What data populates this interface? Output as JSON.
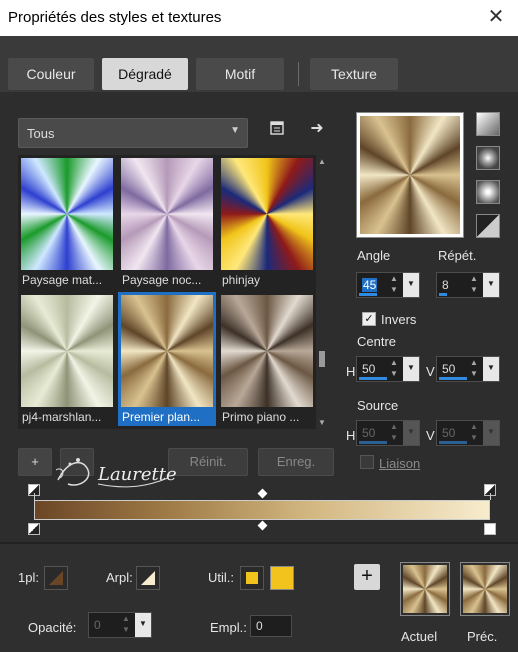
{
  "window": {
    "title": "Propriétés des styles et textures",
    "close_glyph": "✕"
  },
  "tabs": [
    {
      "label": "Couleur",
      "active": false
    },
    {
      "label": "Dégradé",
      "active": true
    },
    {
      "label": "Motif",
      "active": false
    },
    {
      "label": "Texture",
      "active": false
    }
  ],
  "category": {
    "value": "Tous"
  },
  "gradients": [
    {
      "name": "Paysage mat...",
      "colors": [
        "#1a9a2a",
        "#e8f6ff",
        "#2d3fcf",
        "#cfe8ff"
      ]
    },
    {
      "name": "Paysage noc...",
      "colors": [
        "#b59ab8",
        "#e8d6e8",
        "#7f6aa0",
        "#f1e6f0"
      ]
    },
    {
      "name": "phinjay",
      "colors": [
        "#f0c419",
        "#8f1a1a",
        "#1b2a7a",
        "#ffe87a"
      ]
    },
    {
      "name": "pj4-marshlan...",
      "colors": [
        "#b7bca0",
        "#f2f4e6",
        "#8f9478",
        "#e8ecd6"
      ]
    },
    {
      "name": "Premier plan...",
      "colors": [
        "#8a6a3e",
        "#f1e6c4",
        "#5f4528",
        "#d9c290"
      ],
      "selected": true
    },
    {
      "name": "Primo piano ...",
      "colors": [
        "#6b5743",
        "#e2dad0",
        "#3d3127",
        "#b8a898"
      ]
    }
  ],
  "buttons": {
    "add": "+",
    "remove": "-",
    "reset": "Réinit.",
    "save": "Enreg."
  },
  "params": {
    "angle_label": "Angle",
    "angle_value": "45",
    "repeat_label": "Répét.",
    "repeat_value": "8",
    "invert_label": "Invers",
    "invert_checked": true,
    "center_label": "Centre",
    "center_h_label": "H",
    "center_h": "50",
    "center_v_label": "V",
    "center_v": "50",
    "source_label": "Source",
    "source_h_label": "H",
    "source_h": "50",
    "source_v_label": "V",
    "source_v": "50",
    "link_label": "Liaison",
    "link_checked": false
  },
  "logo_text": "Laurette",
  "gradient_bar": {
    "start_color": "#6b4626",
    "end_color": "#f7eccd"
  },
  "bottom": {
    "fg_label": "1pl:",
    "bg_label": "Arpl:",
    "use_label": "Util.:",
    "use_color": "#f2c31c",
    "opacity_label": "Opacité:",
    "opacity_value": "0",
    "location_label": "Empl.:",
    "location_value": "0",
    "add_button": "+",
    "current_label": "Actuel",
    "previous_label": "Préc."
  }
}
